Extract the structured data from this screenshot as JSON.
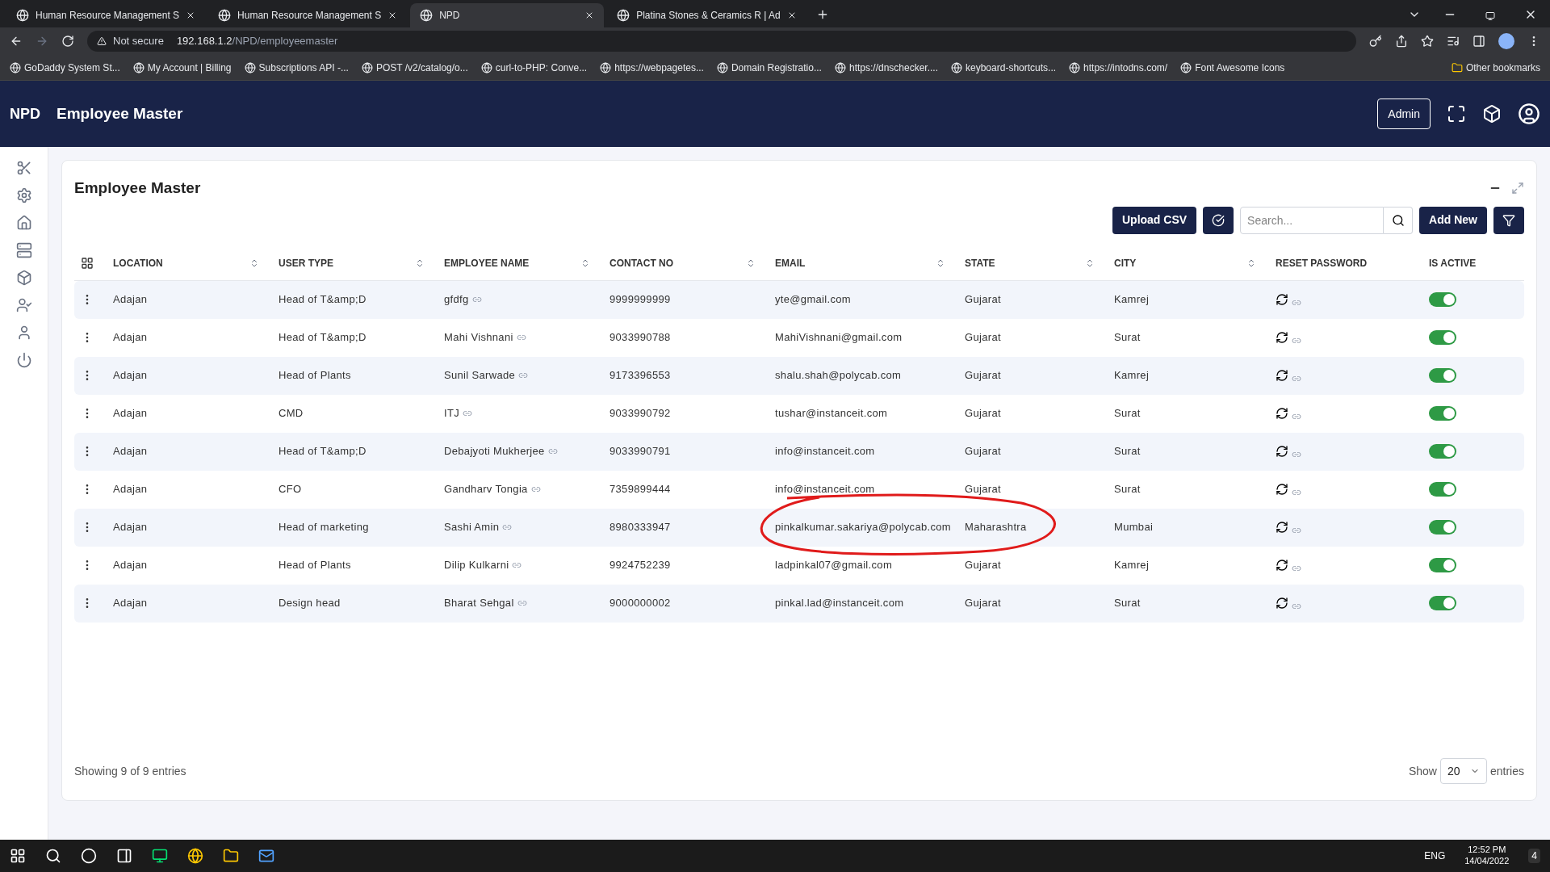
{
  "browser": {
    "tabs": [
      {
        "title": "Human Resource Management S",
        "selected": false
      },
      {
        "title": "Human Resource Management S",
        "selected": false
      },
      {
        "title": "NPD",
        "selected": true
      },
      {
        "title": "Platina Stones & Ceramics R | Ad",
        "selected": false
      }
    ],
    "security": "Not secure",
    "url_host": "192.168.1.2",
    "url_path": "/NPD/employeemaster",
    "bookmarks": [
      "GoDaddy System St...",
      "My Account | Billing",
      "Subscriptions API -...",
      "POST /v2/catalog/o...",
      "curl-to-PHP: Conve...",
      "https://webpagetes...",
      "Domain Registratio...",
      "https://dnschecker....",
      "keyboard-shortcuts...",
      "https://intodns.com/",
      "Font Awesome Icons"
    ],
    "other_bookmarks": "Other bookmarks"
  },
  "header": {
    "logo": "NPD",
    "title": "Employee Master",
    "user_button": "Admin"
  },
  "card": {
    "title": "Employee Master",
    "upload_button": "Upload CSV",
    "search_placeholder": "Search...",
    "add_button": "Add New"
  },
  "table": {
    "columns": [
      {
        "label": "LOCATION",
        "sortable": true
      },
      {
        "label": "USER TYPE",
        "sortable": true
      },
      {
        "label": "EMPLOYEE NAME",
        "sortable": true
      },
      {
        "label": "CONTACT NO",
        "sortable": true
      },
      {
        "label": "EMAIL",
        "sortable": true
      },
      {
        "label": "STATE",
        "sortable": true
      },
      {
        "label": "CITY",
        "sortable": true
      },
      {
        "label": "RESET PASSWORD",
        "sortable": false
      },
      {
        "label": "IS ACTIVE",
        "sortable": false
      }
    ],
    "rows": [
      {
        "location": "Adajan",
        "user_type": "Head of T&amp;D",
        "name": "gfdfg",
        "contact": "9999999999",
        "email": "yte@gmail.com",
        "state": "Gujarat",
        "city": "Kamrej",
        "active": true
      },
      {
        "location": "Adajan",
        "user_type": "Head of T&amp;D",
        "name": "Mahi Vishnani",
        "contact": "9033990788",
        "email": "MahiVishnani@gmail.com",
        "state": "Gujarat",
        "city": "Surat",
        "active": true
      },
      {
        "location": "Adajan",
        "user_type": "Head of Plants",
        "name": "Sunil Sarwade",
        "contact": "9173396553",
        "email": "shalu.shah@polycab.com",
        "state": "Gujarat",
        "city": "Kamrej",
        "active": true
      },
      {
        "location": "Adajan",
        "user_type": "CMD",
        "name": "ITJ",
        "contact": "9033990792",
        "email": "tushar@instanceit.com",
        "state": "Gujarat",
        "city": "Surat",
        "active": true
      },
      {
        "location": "Adajan",
        "user_type": "Head of T&amp;D",
        "name": "Debajyoti Mukherjee",
        "contact": "9033990791",
        "email": "info@instanceit.com",
        "state": "Gujarat",
        "city": "Surat",
        "active": true
      },
      {
        "location": "Adajan",
        "user_type": "CFO",
        "name": "Gandharv Tongia",
        "contact": "7359899444",
        "email": "info@instanceit.com",
        "state": "Gujarat",
        "city": "Surat",
        "active": true
      },
      {
        "location": "Adajan",
        "user_type": "Head of marketing",
        "name": "Sashi Amin",
        "contact": "8980333947",
        "email": "pinkalkumar.sakariya@polycab.com",
        "state": "Maharashtra",
        "city": "Mumbai",
        "active": true
      },
      {
        "location": "Adajan",
        "user_type": "Head of Plants",
        "name": "Dilip Kulkarni",
        "contact": "9924752239",
        "email": "ladpinkal07@gmail.com",
        "state": "Gujarat",
        "city": "Kamrej",
        "active": true
      },
      {
        "location": "Adajan",
        "user_type": "Design head",
        "name": "Bharat Sehgal",
        "contact": "9000000002",
        "email": "pinkal.lad@instanceit.com",
        "state": "Gujarat",
        "city": "Surat",
        "active": true
      }
    ]
  },
  "footer": {
    "summary": "Showing 9 of 9 entries",
    "show_label": "Show",
    "page_size": "20",
    "entries_label": "entries"
  },
  "taskbar": {
    "language": "ENG",
    "time": "12:52 PM",
    "date": "14/04/2022",
    "notifications": "4"
  }
}
